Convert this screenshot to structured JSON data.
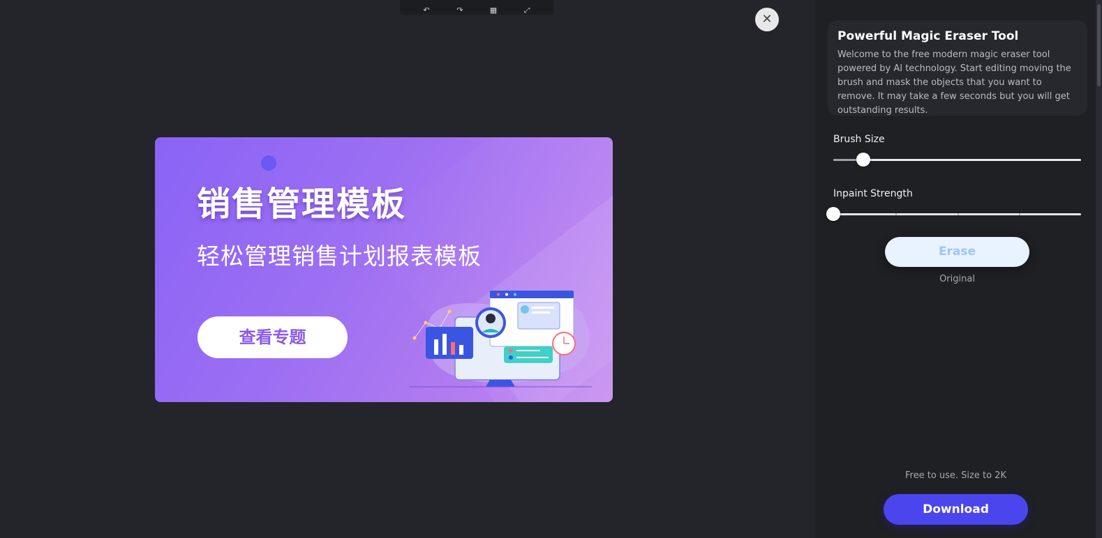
{
  "toolbar": {
    "buttons": [
      {
        "icon": "undo-icon",
        "glyph": "↶"
      },
      {
        "icon": "redo-icon",
        "glyph": "↷"
      },
      {
        "icon": "grid-icon",
        "glyph": "▦"
      },
      {
        "icon": "expand-icon",
        "glyph": "⤢"
      }
    ]
  },
  "canvas": {
    "close_glyph": "✕",
    "banner": {
      "title": "销售管理模板",
      "subtitle": "轻松管理销售计划报表模板",
      "button_label": "查看专题"
    }
  },
  "sidebar": {
    "card": {
      "title": "Powerful Magic Eraser Tool",
      "description": "Welcome to the free modern magic eraser tool powered by AI technology. Start editing moving the brush and mask the objects that you want to remove. It may take a few seconds but you will get outstanding results."
    },
    "brush_size": {
      "label": "Brush Size",
      "value": 0.12
    },
    "inpaint_strength": {
      "label": "Inpaint Strength",
      "value": 0.0,
      "steps": 4
    },
    "erase_label": "Erase",
    "original_label": "Original",
    "free_note": "Free to use. Size to 2K",
    "download_label": "Download"
  },
  "colors": {
    "background": "#23252a",
    "sidebar": "#1e2024",
    "accent": "#4b45ee",
    "banner_start": "#8a63f6",
    "banner_end": "#c58cef"
  }
}
